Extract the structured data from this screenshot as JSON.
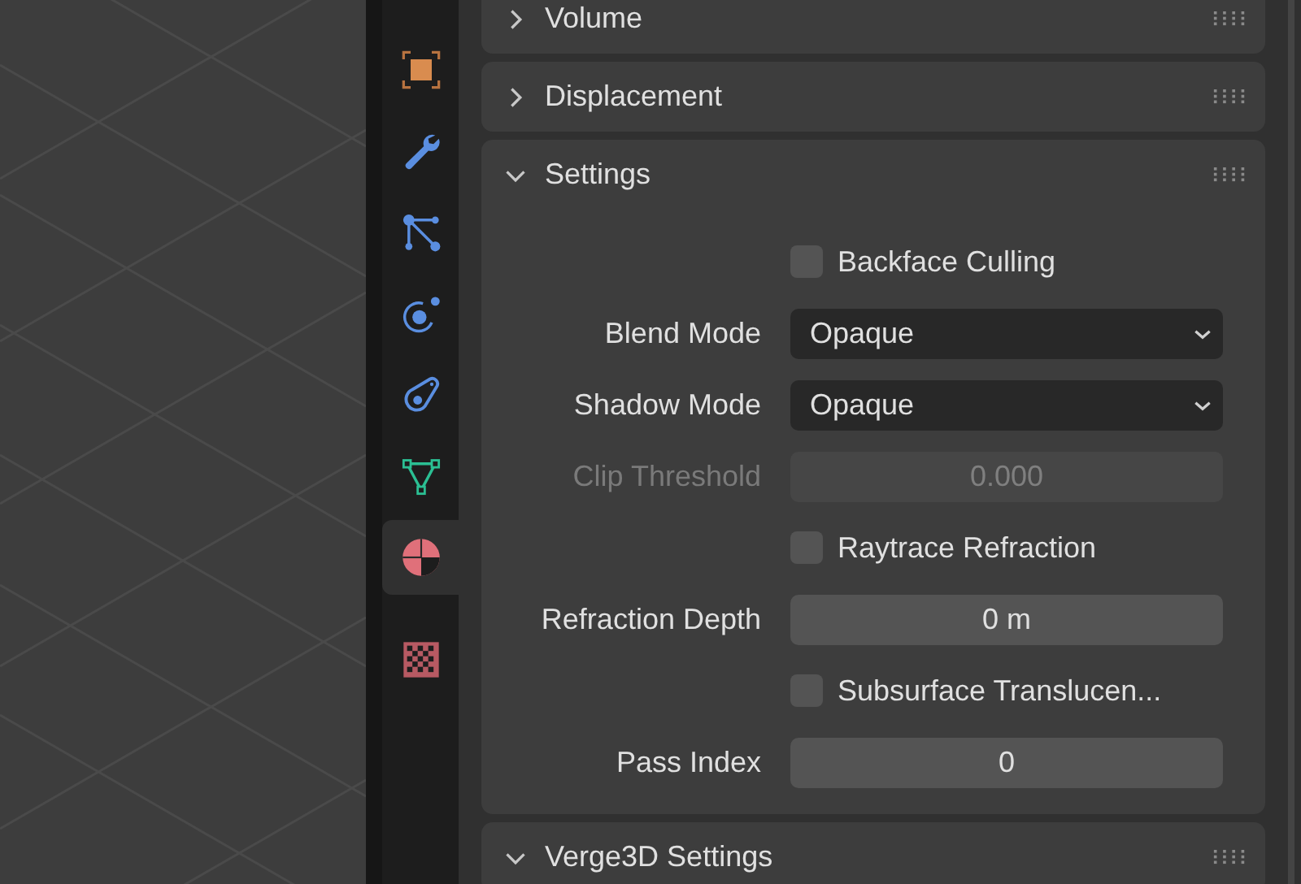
{
  "tabs": [
    {
      "kind": "object",
      "selected": false
    },
    {
      "kind": "modifiers",
      "selected": false
    },
    {
      "kind": "particles",
      "selected": false
    },
    {
      "kind": "physics",
      "selected": false
    },
    {
      "kind": "constraints",
      "selected": false
    },
    {
      "kind": "data",
      "selected": false
    },
    {
      "kind": "material",
      "selected": true
    },
    {
      "kind": "texture",
      "selected": false
    }
  ],
  "panels": [
    {
      "title": "Volume",
      "expanded": false
    },
    {
      "title": "Displacement",
      "expanded": false
    },
    {
      "title": "Settings",
      "expanded": true,
      "rows": [
        {
          "kind": "checkbox",
          "label": "Backface Culling",
          "checked": false
        },
        {
          "kind": "dropdown",
          "label": "Blend Mode",
          "value": "Opaque"
        },
        {
          "kind": "dropdown",
          "label": "Shadow Mode",
          "value": "Opaque"
        },
        {
          "kind": "number",
          "label": "Clip Threshold",
          "value": "0.000",
          "disabled": true
        },
        {
          "kind": "checkbox",
          "label": "Raytrace Refraction",
          "checked": false
        },
        {
          "kind": "number",
          "label": "Refraction Depth",
          "value": "0 m",
          "disabled": false
        },
        {
          "kind": "checkbox",
          "label": "Subsurface Translucen...",
          "checked": false
        },
        {
          "kind": "number",
          "label": "Pass Index",
          "value": "0",
          "disabled": false
        }
      ]
    },
    {
      "title": "Verge3D Settings",
      "expanded": true
    }
  ]
}
